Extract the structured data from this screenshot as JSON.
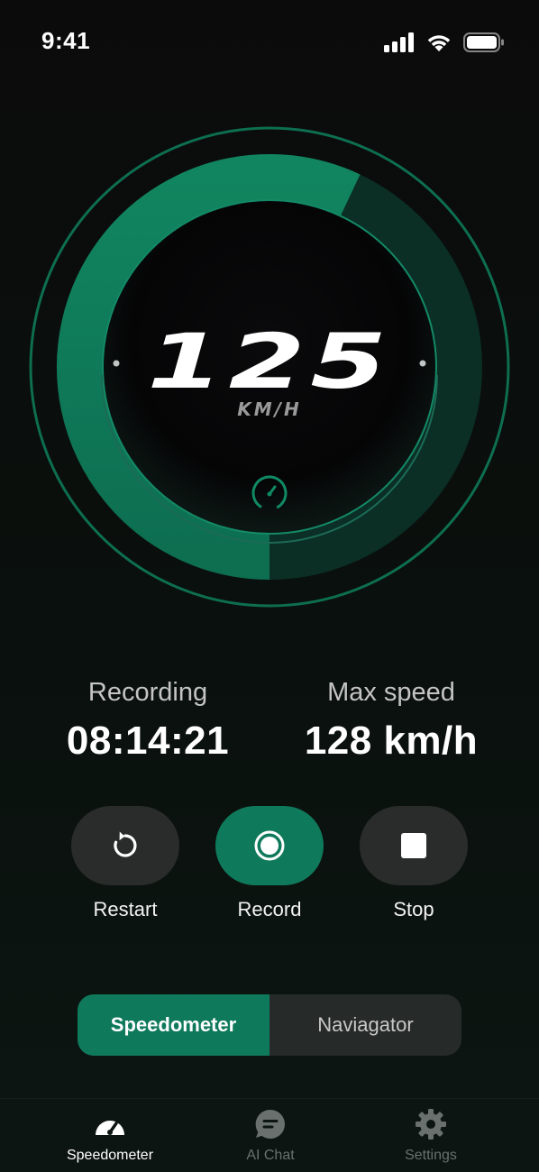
{
  "status_bar": {
    "time": "9:41"
  },
  "speedometer": {
    "speed": "125",
    "unit": "KM/H",
    "progress": 0.57
  },
  "stats": {
    "recording_label": "Recording",
    "recording_value": "08:14:21",
    "max_speed_label": "Max speed",
    "max_speed_value": "128 km/h"
  },
  "controls": {
    "restart_label": "Restart",
    "record_label": "Record",
    "stop_label": "Stop"
  },
  "segment": {
    "active_label": "Speedometer",
    "inactive_label": "Naviagator"
  },
  "tabs": [
    {
      "label": "Speedometer",
      "icon": "speedometer-icon",
      "active": true
    },
    {
      "label": "AI Chat",
      "icon": "chat-icon",
      "active": false
    },
    {
      "label": "Settings",
      "icon": "gear-icon",
      "active": false
    }
  ],
  "colors": {
    "accent": "#0f7a5b",
    "background": "#0b0b0b",
    "button": "#2a2c2b"
  }
}
